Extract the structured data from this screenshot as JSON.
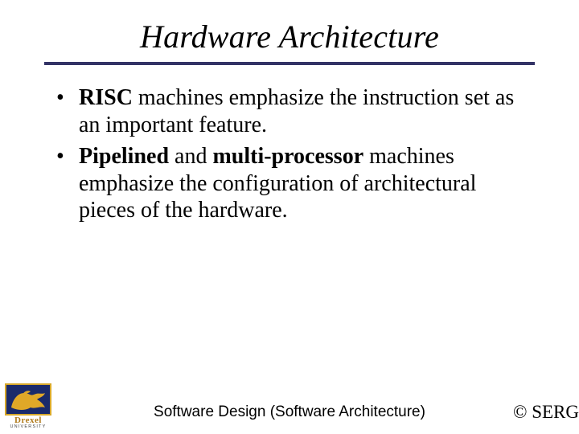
{
  "title": "Hardware Architecture",
  "bullets": [
    {
      "strong": "RISC",
      "rest": " machines emphasize the instruction set as an important feature."
    },
    {
      "strong": "Pipelined",
      "mid": " and ",
      "strong2": "multi-processor",
      "rest": " machines emphasize the configuration of architectural pieces of the hardware."
    }
  ],
  "footer_center": "Software Design (Software Architecture)",
  "footer_right": "© SERG",
  "logo": {
    "label": "Drexel",
    "sub": "UNIVERSITY"
  }
}
